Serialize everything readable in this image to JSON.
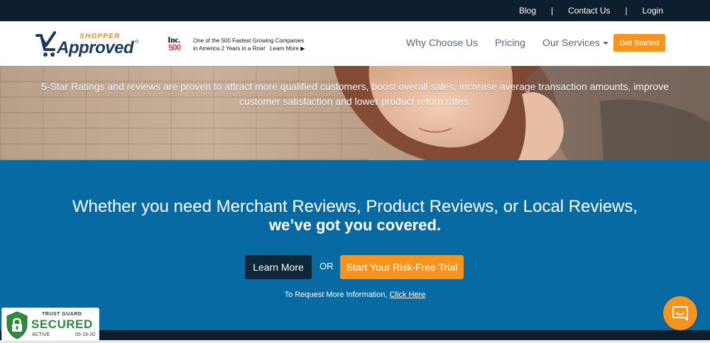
{
  "topbar": {
    "links": [
      "Blog",
      "Contact Us",
      "Login"
    ],
    "separator": "|"
  },
  "header": {
    "logo": {
      "shopper": "SHOPPER",
      "approved": "Approved",
      "reg": "®"
    },
    "inc": {
      "title": "Inc.",
      "number": "500",
      "line1": "One of the 500 Fastest Growing Companies",
      "line2": "in America 2 Years in a Row!",
      "learn_more": "Learn More ▶"
    },
    "nav": {
      "why": "Why Choose Us",
      "pricing": "Pricing",
      "services": "Our Services"
    },
    "cta": "Get Started"
  },
  "hero": {
    "text": "5-Star Ratings and reviews are proven to attract more qualified customers, boost overall sales, increase average transaction amounts, improve customer satisfaction and lower product return rates."
  },
  "main": {
    "headline": "Whether you need Merchant Reviews, Product Reviews, or Local Reviews,",
    "subheadline": "we’ve got you covered.",
    "learn_more": "Learn More",
    "or": "OR",
    "trial": "Start Your Risk-Free Trial",
    "request_prefix": "To Request More Information,",
    "request_link": "Click Here"
  },
  "trust_badge": {
    "top": "TRUST GUARD",
    "main": "SECURED",
    "status": "ACTIVE",
    "date": "05-19-20"
  },
  "colors": {
    "topbar": "#0d1f2e",
    "accent_orange": "#f7941d",
    "blue_section": "#086aa3",
    "logo_navy": "#1d3b5a",
    "trust_green": "#2e8a3c"
  },
  "icons": {
    "chat": "chat-bubble-icon",
    "shield": "shield-lock-icon",
    "cart": "cart-check-icon"
  }
}
